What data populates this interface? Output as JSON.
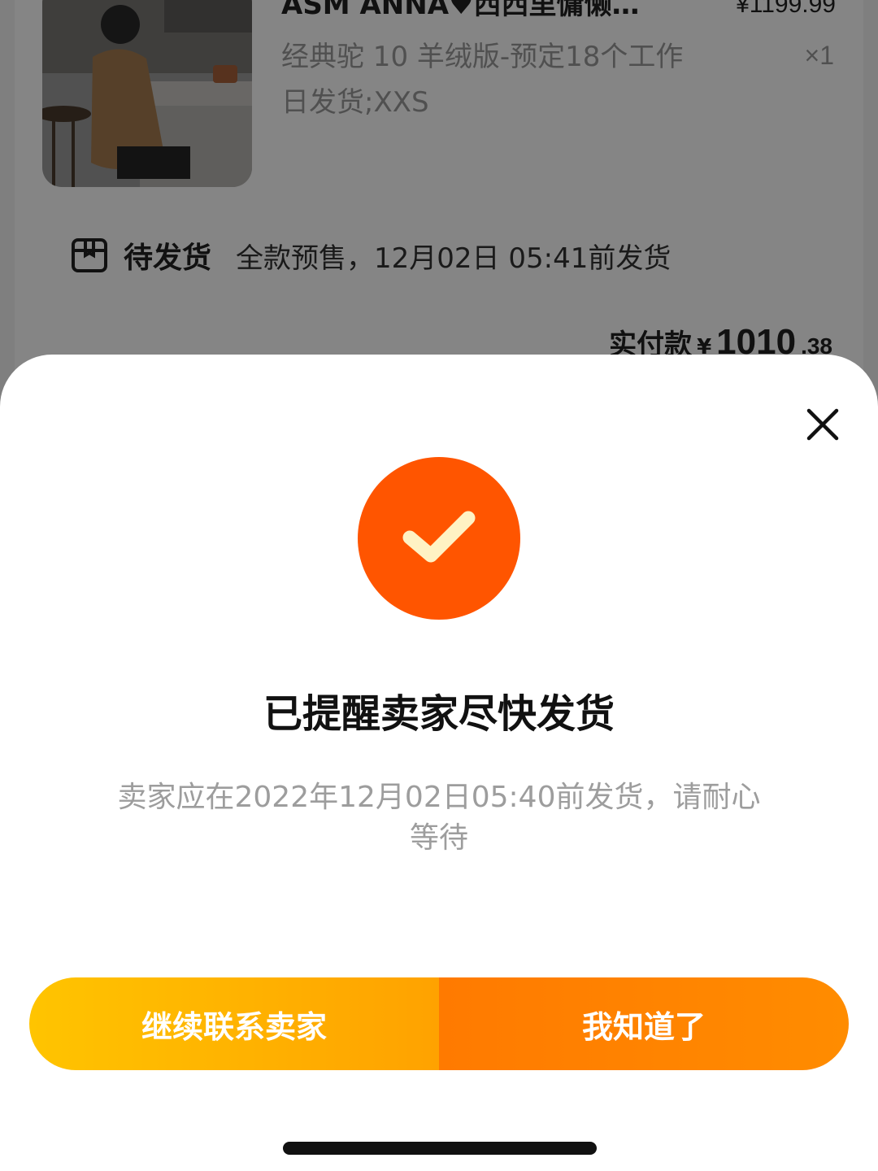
{
  "background": {
    "product": {
      "title": "ASM ANNA♥西西里慵懒…",
      "price": "¥1199.99",
      "spec": "经典驼 10 羊绒版-预定18个工作日发货;XXS",
      "qty": "×1"
    },
    "shipping": {
      "icon": "box-icon",
      "status": "待发货",
      "description": "全款预售，12月02日 05:41前发货"
    },
    "payment": {
      "label": "实付款",
      "currency": "¥",
      "amount_int": "1010",
      "amount_dec": ".38"
    }
  },
  "sheet": {
    "close_icon": "close-icon",
    "badge_icon": "check-icon",
    "accent_color": "#ff5500",
    "title": "已提醒卖家尽快发货",
    "message": "卖家应在2022年12月02日05:40前发货，请耐心等待",
    "buttons": {
      "contact_label": "继续联系卖家",
      "ok_label": "我知道了"
    }
  }
}
